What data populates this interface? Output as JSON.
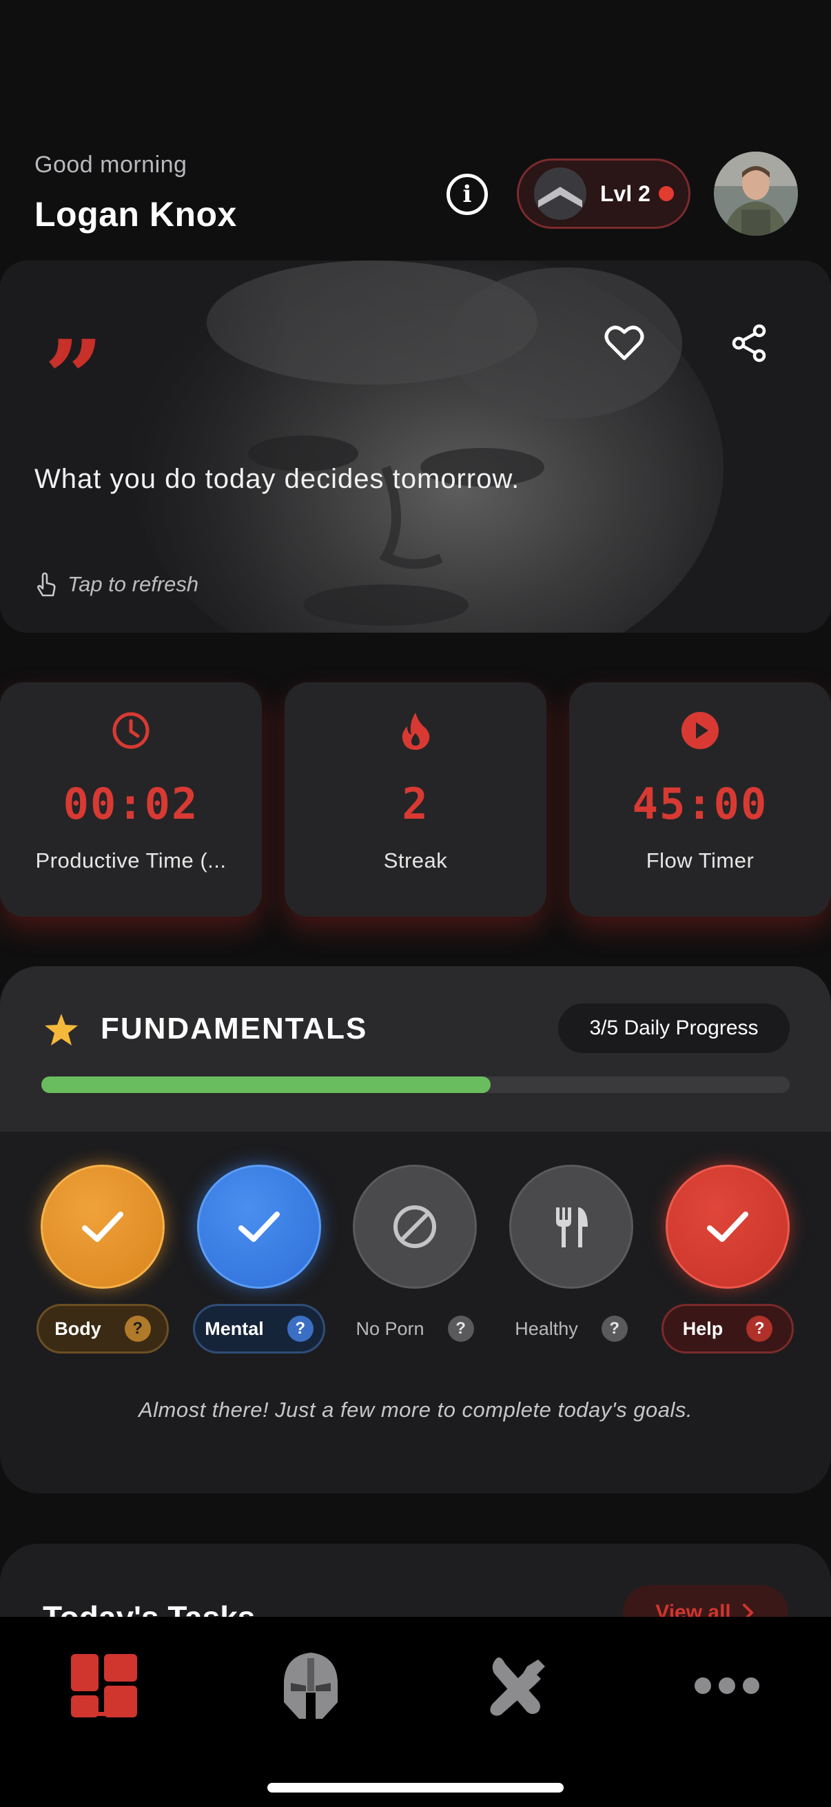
{
  "header": {
    "greeting": "Good morning",
    "username": "Logan Knox",
    "level_label": "Lvl 2",
    "icons": {
      "info": "info-icon",
      "level": "chevron-rank-badge",
      "avatar": "user-avatar"
    }
  },
  "quote": {
    "text": "What you do today decides tomorrow.",
    "mark": "”",
    "refresh_label": "Tap to refresh",
    "icons": {
      "favorite": "heart-icon",
      "share": "share-icon",
      "refresh": "tap-hand-icon"
    }
  },
  "stats": [
    {
      "icon": "clock-icon",
      "value": "00:02",
      "label": "Productive Time (..."
    },
    {
      "icon": "flame-icon",
      "value": "2",
      "label": "Streak"
    },
    {
      "icon": "play-icon",
      "value": "45:00",
      "label": "Flow Timer"
    }
  ],
  "fundamentals": {
    "title": "FUNDAMENTALS",
    "badge": "3/5 Daily Progress",
    "progress": 0.6,
    "habits": [
      {
        "label": "Body",
        "state": "done",
        "help": "?"
      },
      {
        "label": "Mental",
        "state": "done",
        "help": "?"
      },
      {
        "label": "No Porn",
        "state": "pending",
        "help": "?"
      },
      {
        "label": "Healthy",
        "state": "pending",
        "help": "?"
      },
      {
        "label": "Help",
        "state": "done",
        "help": "?"
      }
    ],
    "message": "Almost there! Just a few more to complete today's goals."
  },
  "tasks": {
    "title": "Today's Tasks",
    "view_all": "View all"
  },
  "tabbar": {
    "tabs": [
      "dashboard-icon",
      "helmet-icon",
      "tools-icon",
      "more-icon"
    ],
    "active": 0
  },
  "colors": {
    "accent": "#d0352e",
    "body": "#e8952a",
    "mental": "#3a7fe6",
    "progress": "#6abd5e",
    "background": "#0f0f10"
  }
}
